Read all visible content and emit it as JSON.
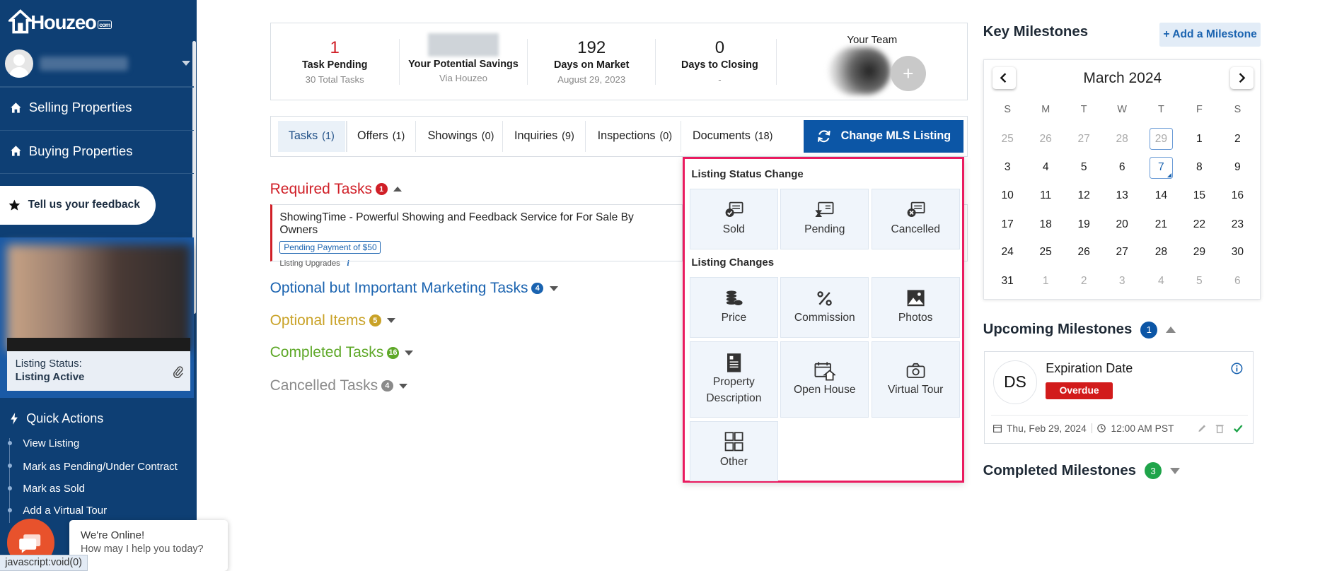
{
  "brand": {
    "name": "Houzeo",
    "tm": "com"
  },
  "sidebar": {
    "nav": [
      {
        "label": "Selling Properties",
        "icon": "home-icon"
      },
      {
        "label": "Buying Properties",
        "icon": "home-icon"
      }
    ],
    "feedback_label": "Tell us your feedback",
    "listing_status_label": "Listing Status:",
    "listing_status_value": "Listing Active",
    "quick_actions_title": "Quick Actions",
    "quick_actions": [
      "View Listing",
      "Mark as Pending/Under Contract",
      "Mark as Sold",
      "Add a Virtual Tour"
    ]
  },
  "chat": {
    "title": "We're Online!",
    "subtitle": "How may I help you today?"
  },
  "status_url": "javascript:void(0)",
  "stats": {
    "tasks": {
      "value": "1",
      "label": "Task Pending",
      "sub": "30 Total Tasks"
    },
    "savings": {
      "label": "Your Potential Savings",
      "sub": "Via Houzeo"
    },
    "market": {
      "value": "192",
      "label": "Days on Market",
      "sub": "August 29, 2023"
    },
    "closing": {
      "value": "0",
      "label": "Days to Closing",
      "sub": "-"
    },
    "team": {
      "label": "Your Team",
      "add": "+"
    }
  },
  "tabs": [
    {
      "label": "Tasks",
      "count": "(1)"
    },
    {
      "label": "Offers",
      "count": "(1)"
    },
    {
      "label": "Showings",
      "count": "(0)"
    },
    {
      "label": "Inquiries",
      "count": "(9)"
    },
    {
      "label": "Inspections",
      "count": "(0)"
    },
    {
      "label": "Documents",
      "count": "(18)"
    }
  ],
  "mls_button": "Change MLS Listing",
  "sections": {
    "required": {
      "title": "Required Tasks",
      "count": "1",
      "color": "#d01f27"
    },
    "optional_marketing": {
      "title": "Optional but Important Marketing Tasks",
      "count": "4",
      "color": "#1a63b0"
    },
    "optional_items": {
      "title": "Optional Items",
      "count": "5",
      "color": "#c9a227"
    },
    "completed": {
      "title": "Completed Tasks",
      "count": "16",
      "color": "#5ea828"
    },
    "cancelled": {
      "title": "Cancelled Tasks",
      "count": "4",
      "color": "#8a8a8a"
    }
  },
  "required_task": {
    "title": "ShowingTime - Powerful Showing and Feedback Service for For Sale By Owners",
    "pill": "Pending Payment of $50",
    "category": "Listing Upgrades",
    "info": "i"
  },
  "dropdown": {
    "status_head": "Listing Status Change",
    "status_options": [
      "Sold",
      "Pending",
      "Cancelled"
    ],
    "changes_head": "Listing Changes",
    "change_options": [
      "Price",
      "Commission",
      "Photos",
      "Property Description",
      "Open House",
      "Virtual Tour",
      "Other"
    ]
  },
  "milestones": {
    "title": "Key Milestones",
    "add_label": "+ Add a Milestone",
    "calendar": {
      "month": "March 2024",
      "dow": [
        "S",
        "M",
        "T",
        "W",
        "T",
        "F",
        "S"
      ],
      "weeks": [
        [
          "25",
          "26",
          "27",
          "28",
          "29",
          "1",
          "2"
        ],
        [
          "3",
          "4",
          "5",
          "6",
          "7",
          "8",
          "9"
        ],
        [
          "10",
          "11",
          "12",
          "13",
          "14",
          "15",
          "16"
        ],
        [
          "17",
          "18",
          "19",
          "20",
          "21",
          "22",
          "23"
        ],
        [
          "24",
          "25",
          "26",
          "27",
          "28",
          "29",
          "30"
        ],
        [
          "31",
          "1",
          "2",
          "3",
          "4",
          "5",
          "6"
        ]
      ]
    },
    "upcoming_title": "Upcoming Milestones",
    "upcoming_count": "1",
    "card": {
      "initials": "DS",
      "name": "Expiration Date",
      "status": "Overdue",
      "date": "Thu, Feb 29, 2024",
      "time": "12:00 AM PST"
    },
    "completed_title": "Completed Milestones",
    "completed_count": "3"
  }
}
